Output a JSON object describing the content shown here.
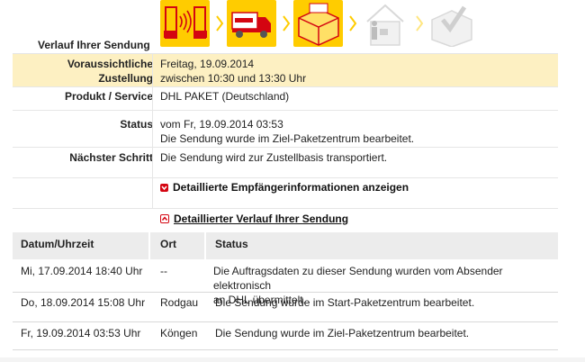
{
  "header": {
    "title": "Verlauf Ihrer Sendung"
  },
  "progress": {
    "steps": [
      {
        "icon": "parcel-shop-icon",
        "state": "done"
      },
      {
        "icon": "delivery-truck-icon",
        "state": "done"
      },
      {
        "icon": "parcel-center-icon",
        "state": "done"
      },
      {
        "icon": "courier-house-icon",
        "state": "pending"
      },
      {
        "icon": "delivered-checkbox-icon",
        "state": "pending"
      }
    ],
    "colors": {
      "active": "#ffcc00",
      "inactive": "#e8e8e8",
      "accent": "#d40511"
    }
  },
  "info": {
    "delivery_label_1": "Voraussichtliche",
    "delivery_label_2": "Zustellung",
    "delivery_date": "Freitag, 19.09.2014",
    "delivery_time": "zwischen 10:30 und 13:30 Uhr",
    "product_label": "Produkt / Service",
    "product_value": "DHL PAKET (Deutschland)",
    "status_label": "Status",
    "status_line1": "vom Fr, 19.09.2014 03:53",
    "status_line2": "Die Sendung wurde im Ziel-Paketzentrum bearbeitet.",
    "next_label": "Nächster Schritt",
    "next_value": "Die Sendung wird zur Zustellbasis transportiert."
  },
  "toggles": {
    "recipient": "Detaillierte Empfängerinformationen anzeigen",
    "history": "Detaillierter Verlauf Ihrer Sendung"
  },
  "history": {
    "columns": [
      "Datum/Uhrzeit",
      "Ort",
      "Status"
    ],
    "rows": [
      {
        "date": "Mi, 17.09.2014 18:40 Uhr",
        "place": "--",
        "status1": "Die Auftragsdaten zu dieser Sendung wurden vom Absender elektronisch",
        "status2": "an DHL übermittelt."
      },
      {
        "date": "Do, 18.09.2014 15:08 Uhr",
        "place": "Rodgau",
        "status1": "Die Sendung wurde im Start-Paketzentrum bearbeitet.",
        "status2": ""
      },
      {
        "date": "Fr, 19.09.2014 03:53 Uhr",
        "place": "Köngen",
        "status1": "Die Sendung wurde im Ziel-Paketzentrum bearbeitet.",
        "status2": ""
      }
    ]
  }
}
